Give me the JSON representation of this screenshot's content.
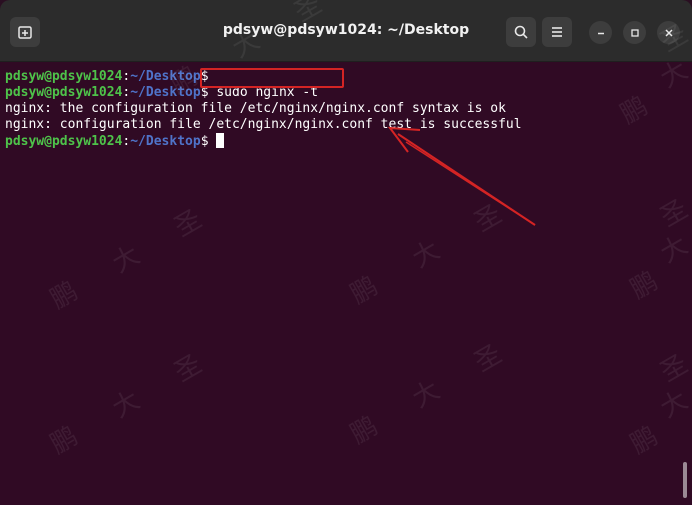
{
  "window": {
    "title": "pdsyw@pdsyw1024: ~/Desktop"
  },
  "titlebar": {
    "icons": {
      "new_tab": "new-tab-icon",
      "search": "search-icon",
      "menu": "hamburger-menu-icon",
      "minimize": "minimize-icon",
      "maximize": "maximize-icon",
      "close": "close-icon"
    }
  },
  "terminal": {
    "lines": [
      {
        "user": "pdsyw@pdsyw1024",
        "sep": ":",
        "path": "~/Desktop",
        "prompt": "$",
        "cmd": ""
      },
      {
        "user": "pdsyw@pdsyw1024",
        "sep": ":",
        "path": "~/Desktop",
        "prompt": "$",
        "cmd": " sudo nginx -t"
      },
      {
        "output": "nginx: the configuration file /etc/nginx/nginx.conf syntax is ok"
      },
      {
        "output": "nginx: configuration file /etc/nginx/nginx.conf test is successful"
      },
      {
        "user": "pdsyw@pdsyw1024",
        "sep": ":",
        "path": "~/Desktop",
        "prompt": "$",
        "cmd": " "
      }
    ]
  },
  "watermark": {
    "chars": [
      "鹏",
      "大",
      "圣"
    ]
  },
  "colors": {
    "terminal_bg": "#300a24",
    "titlebar_bg": "#2c2c2c",
    "prompt_user": "#4ec34a",
    "prompt_path": "#4f73c9",
    "annotation": "#d42424"
  }
}
